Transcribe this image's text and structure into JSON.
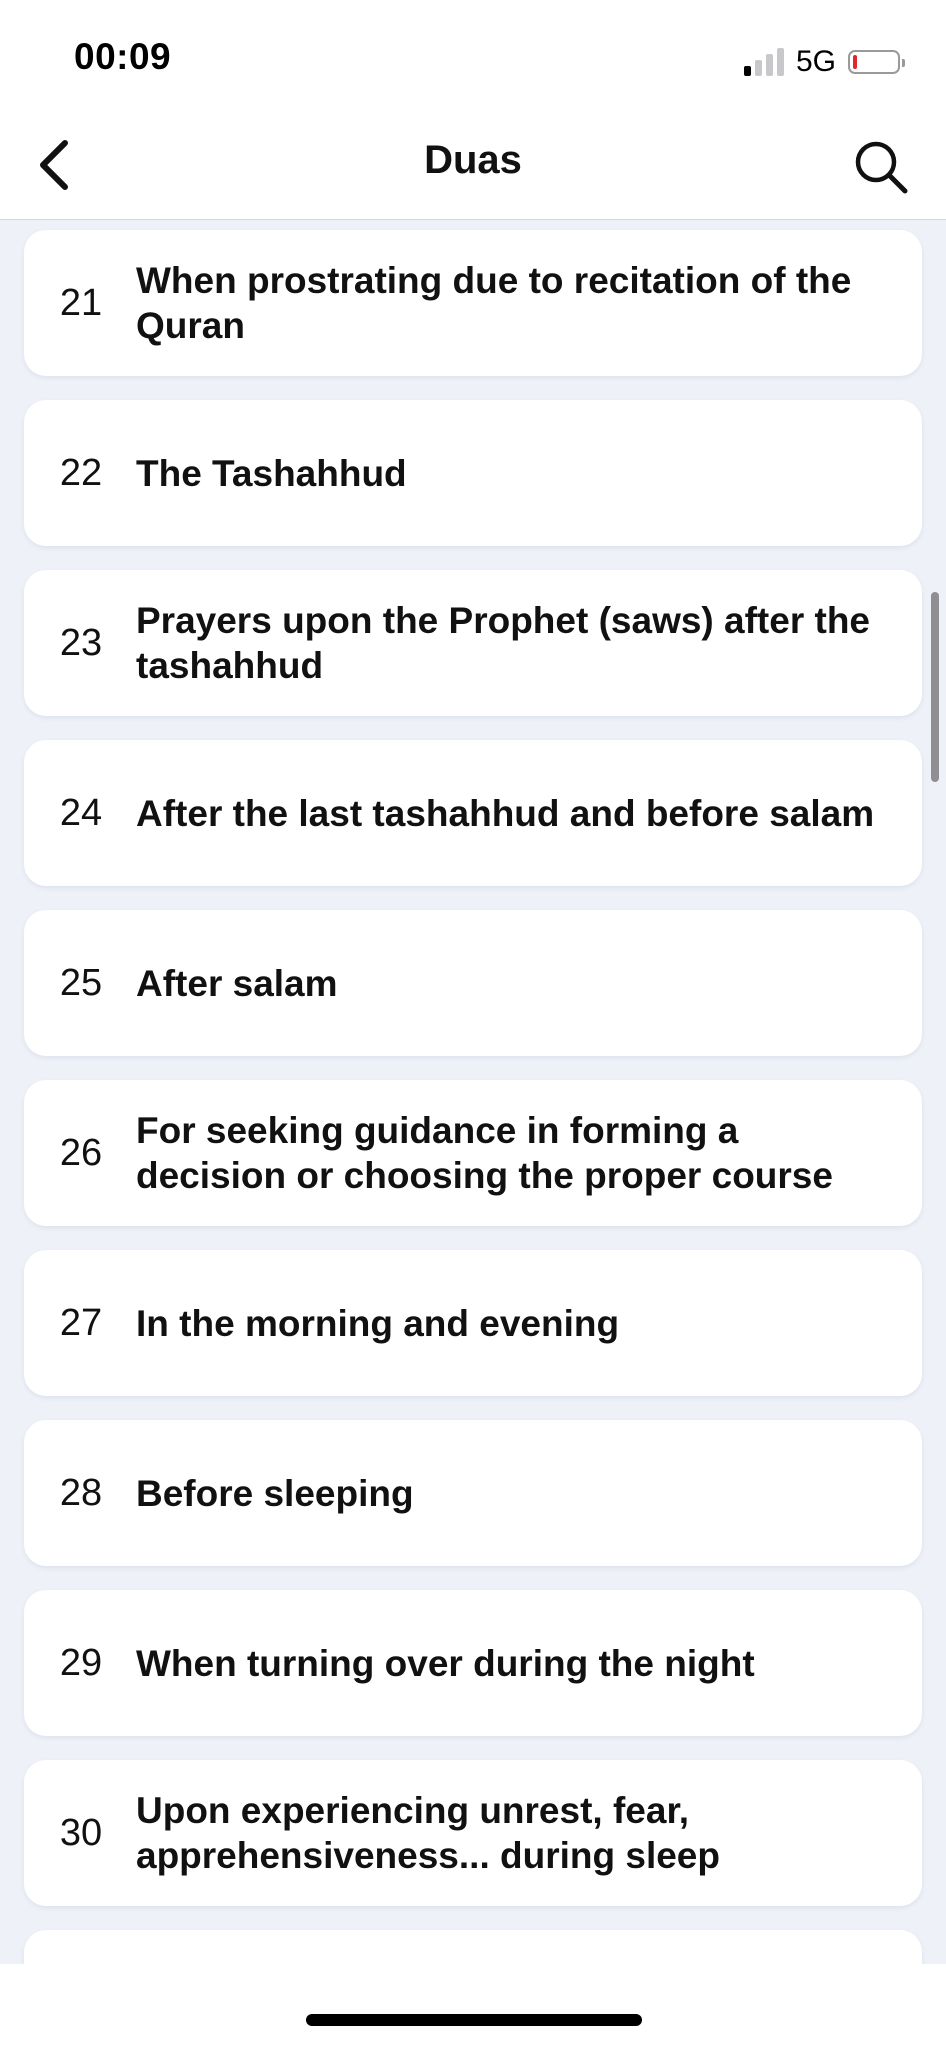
{
  "status_bar": {
    "time": "00:09",
    "network": "5G",
    "signal_bars_active": 1,
    "signal_bars_total": 4,
    "battery_level": 0.05,
    "battery_color": "#e3262c"
  },
  "nav": {
    "title": "Duas",
    "back_icon": "chevron-left-icon",
    "search_icon": "search-icon"
  },
  "duas": [
    {
      "number": "21",
      "title": "When prostrating due to recitation of the Quran"
    },
    {
      "number": "22",
      "title": "The Tashahhud"
    },
    {
      "number": "23",
      "title": "Prayers upon the Prophet (saws) after the tashahhud"
    },
    {
      "number": "24",
      "title": "After the last tashahhud and before salam"
    },
    {
      "number": "25",
      "title": "After salam"
    },
    {
      "number": "26",
      "title": "For seeking guidance in forming a decision or choosing the proper course"
    },
    {
      "number": "27",
      "title": "In the morning and evening"
    },
    {
      "number": "28",
      "title": "Before sleeping"
    },
    {
      "number": "29",
      "title": "When turning over during the night"
    },
    {
      "number": "30",
      "title": "Upon experiencing unrest, fear, apprehensiveness... during sleep"
    }
  ],
  "colors": {
    "list_background": "#eef1f8",
    "card_background": "#ffffff",
    "text": "#111111"
  }
}
